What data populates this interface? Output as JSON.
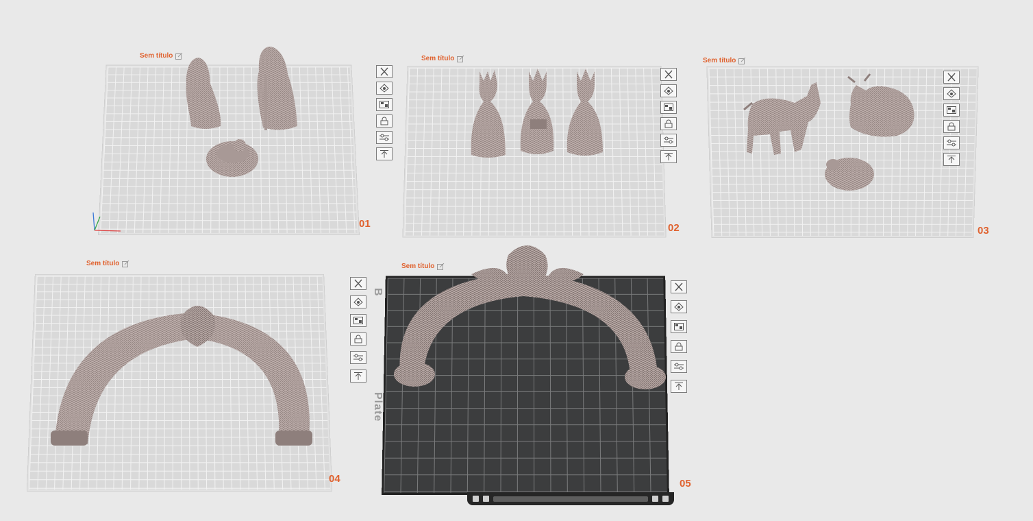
{
  "plates": [
    {
      "title": "Sem título",
      "number": "01"
    },
    {
      "title": "Sem título",
      "number": "02"
    },
    {
      "title": "Sem título",
      "number": "03"
    },
    {
      "title": "Sem título",
      "number": "04"
    },
    {
      "title": "Sem título",
      "number": "05"
    }
  ],
  "plate_label_parts": [
    "B",
    "Plate"
  ],
  "toolbar_icons": [
    "close-icon",
    "auto-orient-icon",
    "arrange-icon",
    "lock-icon",
    "settings-icon",
    "move-to-top-icon"
  ],
  "colors": {
    "accent": "#e0622f",
    "model": "#bdaeab",
    "grid_light": "#d9d9d9",
    "grid_dark": "#3c3d3e"
  }
}
